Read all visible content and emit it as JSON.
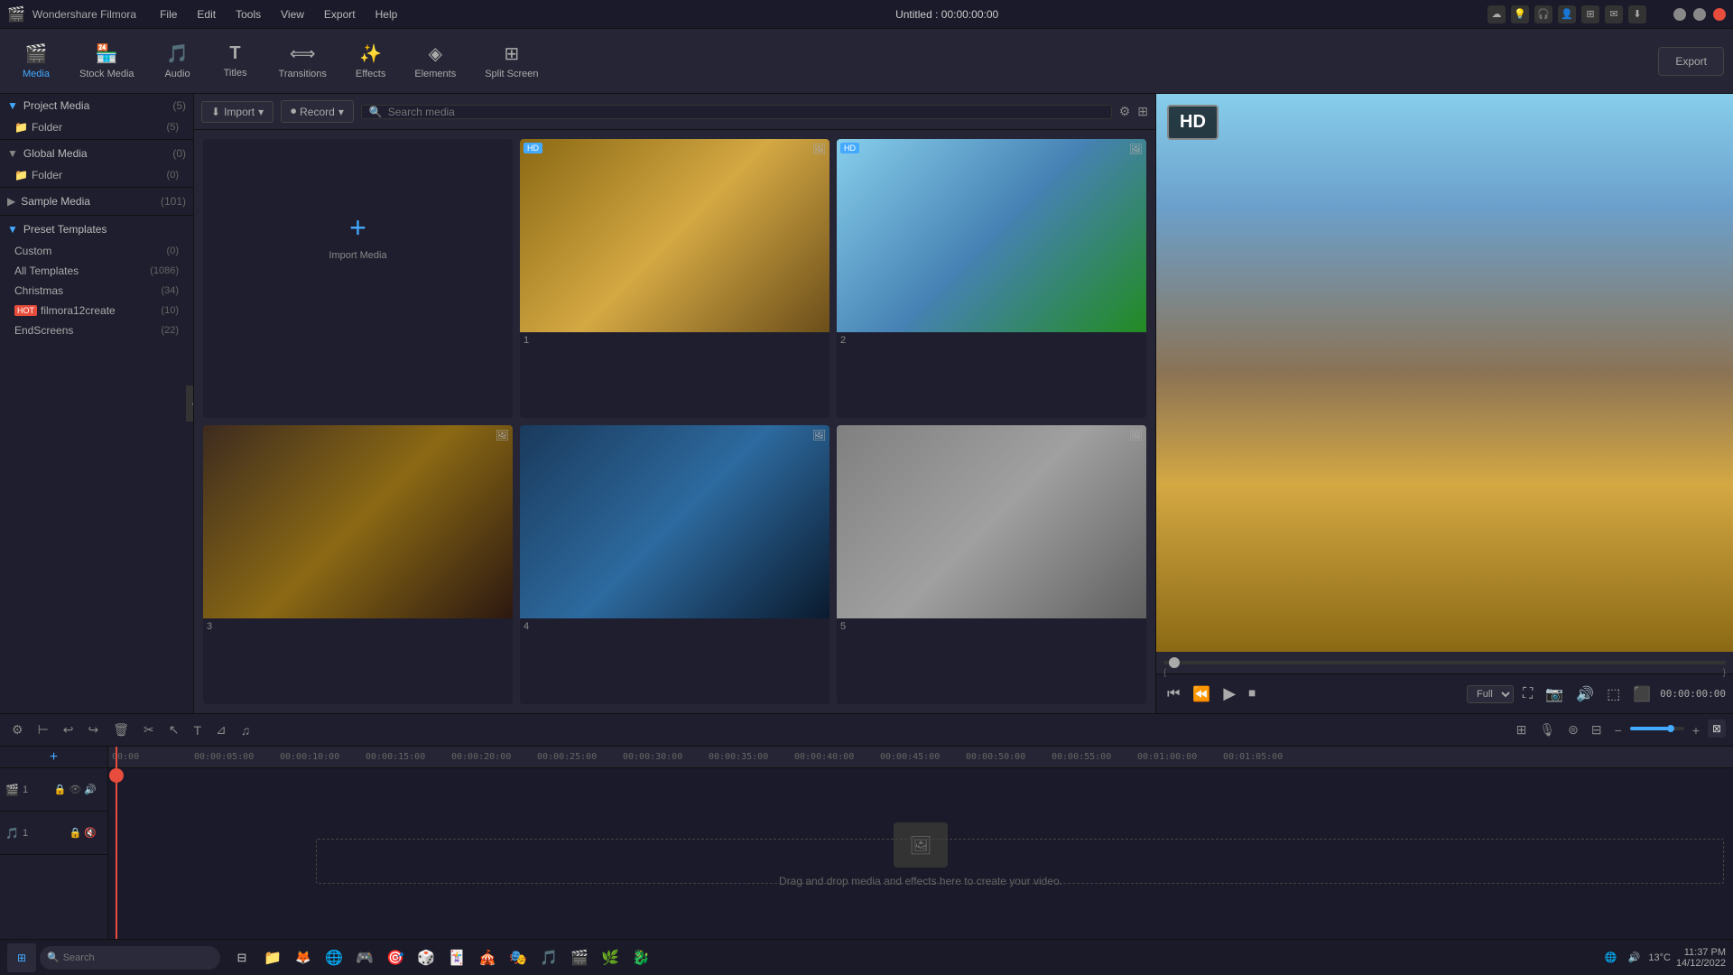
{
  "titlebar": {
    "app_name": "Wondershare Filmora",
    "project_title": "Untitled : 00:00:00:00",
    "menu_items": [
      "File",
      "Edit",
      "Tools",
      "View",
      "Export",
      "Help"
    ]
  },
  "toolbar": {
    "items": [
      {
        "id": "media",
        "label": "Media",
        "icon": "🎬",
        "active": true
      },
      {
        "id": "stock",
        "label": "Stock Media",
        "icon": "🏪"
      },
      {
        "id": "audio",
        "label": "Audio",
        "icon": "🎵"
      },
      {
        "id": "titles",
        "label": "Titles",
        "icon": "T"
      },
      {
        "id": "transitions",
        "label": "Transitions",
        "icon": "⟺"
      },
      {
        "id": "effects",
        "label": "Effects",
        "icon": "✨"
      },
      {
        "id": "elements",
        "label": "Elements",
        "icon": "◈"
      },
      {
        "id": "splitscreen",
        "label": "Split Screen",
        "icon": "⊞"
      }
    ],
    "export_label": "Export"
  },
  "left_panel": {
    "sections": [
      {
        "id": "project_media",
        "label": "Project Media",
        "count": 5,
        "expanded": true,
        "items": [
          {
            "label": "Folder",
            "count": 5
          }
        ]
      },
      {
        "id": "global_media",
        "label": "Global Media",
        "count": 0,
        "expanded": true,
        "items": [
          {
            "label": "Folder",
            "count": 0
          }
        ]
      },
      {
        "id": "sample_media",
        "label": "Sample Media",
        "count": 101,
        "expanded": false,
        "items": []
      },
      {
        "id": "preset_templates",
        "label": "Preset Templates",
        "count": null,
        "expanded": true,
        "items": [
          {
            "label": "Custom",
            "count": 0
          },
          {
            "label": "All Templates",
            "count": 1086
          },
          {
            "label": "Christmas",
            "count": 34
          },
          {
            "label": "filmora12create",
            "count": 10,
            "hot": true
          },
          {
            "label": "EndScreens",
            "count": 22
          }
        ]
      }
    ]
  },
  "media_panel": {
    "import_label": "Import",
    "record_label": "Record",
    "search_placeholder": "Search media",
    "items": [
      {
        "id": "import",
        "type": "import",
        "label": "Import Media"
      },
      {
        "id": "1",
        "label": "1",
        "badge": "HD",
        "thumb_class": "thumb-1"
      },
      {
        "id": "2",
        "label": "2",
        "badge": "HD",
        "thumb_class": "thumb-2"
      },
      {
        "id": "3",
        "label": "3",
        "badge": null,
        "thumb_class": "thumb-3"
      },
      {
        "id": "4",
        "label": "4",
        "badge": null,
        "thumb_class": "thumb-4"
      },
      {
        "id": "5",
        "label": "5",
        "badge": null,
        "thumb_class": "thumb-5"
      }
    ]
  },
  "preview": {
    "time_display": "00:00:00:00",
    "quality": "Full",
    "hd_label": "HD"
  },
  "timeline": {
    "ruler_ticks": [
      "00:00",
      "00:05:00",
      "00:10:00",
      "00:15:00",
      "00:20:00",
      "00:25:00",
      "00:30:00",
      "00:35:00",
      "00:40:00",
      "00:45:00",
      "00:50:00",
      "00:55:00",
      "01:00:00",
      "01:05:00"
    ],
    "drop_text": "Drag and drop media and effects here to create your video.",
    "tracks": [
      {
        "id": "video1",
        "type": "video",
        "number": 1
      },
      {
        "id": "audio1",
        "type": "audio",
        "number": 1
      }
    ]
  },
  "taskbar": {
    "time": "11:37 PM",
    "date": "14/12/2022",
    "temp": "13°C",
    "search_placeholder": "Search"
  }
}
